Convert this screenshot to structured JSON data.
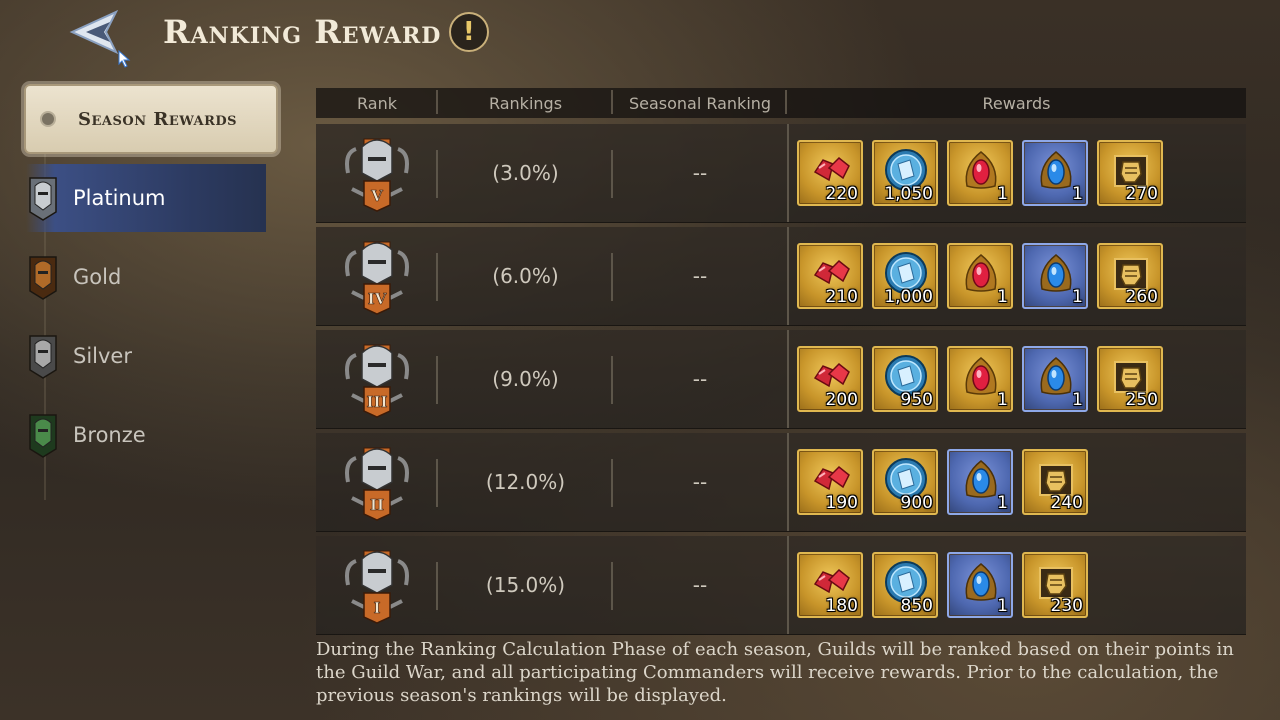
{
  "header": {
    "title": "Ranking Reward",
    "info_glyph": "!"
  },
  "sidebar": {
    "season_tab": "Season Rewards",
    "tiers": [
      {
        "label": "Platinum",
        "active": true,
        "icon": "platinum-tier-icon"
      },
      {
        "label": "Gold",
        "active": false,
        "icon": "gold-tier-icon"
      },
      {
        "label": "Silver",
        "active": false,
        "icon": "silver-tier-icon"
      },
      {
        "label": "Bronze",
        "active": false,
        "icon": "bronze-tier-icon"
      }
    ]
  },
  "table": {
    "headers": {
      "rank": "Rank",
      "rankings": "Rankings",
      "seasonal": "Seasonal Ranking",
      "rewards": "Rewards"
    },
    "rows": [
      {
        "rank_numeral": "V",
        "rankings": "(3.0%)",
        "seasonal": "--",
        "rewards": [
          {
            "icon": "ruby-icon",
            "qty": "220",
            "frame": "gold"
          },
          {
            "icon": "blue-coin-icon",
            "qty": "1,050",
            "frame": "gold"
          },
          {
            "icon": "red-gem-icon",
            "qty": "1",
            "frame": "gold"
          },
          {
            "icon": "blue-gem-icon",
            "qty": "1",
            "frame": "blue"
          },
          {
            "icon": "guild-fist-icon",
            "qty": "270",
            "frame": "gold"
          }
        ]
      },
      {
        "rank_numeral": "IV",
        "rankings": "(6.0%)",
        "seasonal": "--",
        "rewards": [
          {
            "icon": "ruby-icon",
            "qty": "210",
            "frame": "gold"
          },
          {
            "icon": "blue-coin-icon",
            "qty": "1,000",
            "frame": "gold"
          },
          {
            "icon": "red-gem-icon",
            "qty": "1",
            "frame": "gold"
          },
          {
            "icon": "blue-gem-icon",
            "qty": "1",
            "frame": "blue"
          },
          {
            "icon": "guild-fist-icon",
            "qty": "260",
            "frame": "gold"
          }
        ]
      },
      {
        "rank_numeral": "III",
        "rankings": "(9.0%)",
        "seasonal": "--",
        "rewards": [
          {
            "icon": "ruby-icon",
            "qty": "200",
            "frame": "gold"
          },
          {
            "icon": "blue-coin-icon",
            "qty": "950",
            "frame": "gold"
          },
          {
            "icon": "red-gem-icon",
            "qty": "1",
            "frame": "gold"
          },
          {
            "icon": "blue-gem-icon",
            "qty": "1",
            "frame": "blue"
          },
          {
            "icon": "guild-fist-icon",
            "qty": "250",
            "frame": "gold"
          }
        ]
      },
      {
        "rank_numeral": "II",
        "rankings": "(12.0%)",
        "seasonal": "--",
        "rewards": [
          {
            "icon": "ruby-icon",
            "qty": "190",
            "frame": "gold"
          },
          {
            "icon": "blue-coin-icon",
            "qty": "900",
            "frame": "gold"
          },
          {
            "icon": "blue-gem-icon",
            "qty": "1",
            "frame": "blue"
          },
          {
            "icon": "guild-fist-icon",
            "qty": "240",
            "frame": "gold"
          }
        ]
      },
      {
        "rank_numeral": "I",
        "rankings": "(15.0%)",
        "seasonal": "--",
        "rewards": [
          {
            "icon": "ruby-icon",
            "qty": "180",
            "frame": "gold"
          },
          {
            "icon": "blue-coin-icon",
            "qty": "850",
            "frame": "gold"
          },
          {
            "icon": "blue-gem-icon",
            "qty": "1",
            "frame": "blue"
          },
          {
            "icon": "guild-fist-icon",
            "qty": "230",
            "frame": "gold"
          }
        ]
      }
    ]
  },
  "footer": {
    "description": "During the Ranking Calculation Phase of each season, Guilds will be ranked based on their points in the Guild War, and all participating Commanders will receive rewards. Prior to the calculation, the previous season's rankings will be displayed."
  }
}
